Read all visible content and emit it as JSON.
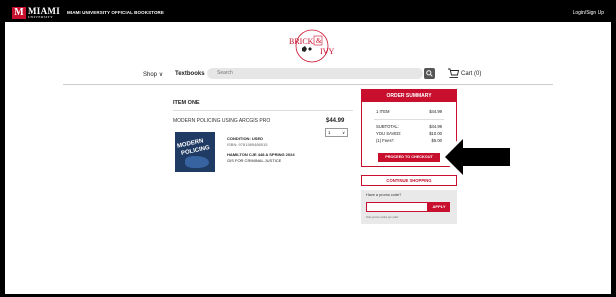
{
  "header": {
    "logo_line1": "MIAMI",
    "logo_line2": "UNIVERSITY",
    "store_title": "MIAMI UNIVERSITY OFFICIAL BOOKSTORE",
    "login": "Login/Sign Up"
  },
  "brand": {
    "word1": "BRICK",
    "amp": "&",
    "word2": "IVY"
  },
  "nav": {
    "shop": "Shop",
    "textbooks": "Textbooks",
    "search_placeholder": "Search",
    "cart": "Cart (0)"
  },
  "item": {
    "heading": "ITEM ONE",
    "title": "MODERN POLICING USING ARCGIS PRO",
    "price": "$44.99",
    "quantity": "1",
    "cover_word1": "MODERN",
    "cover_word2": "POLICING",
    "condition": "CONDITION: USED",
    "isbn": "ISBN: 9781589486515",
    "course": "HAMILTON CJE 448 A SPRING 2024",
    "course_desc": "GIS FOR CRIMINAL JUSTICE"
  },
  "summary": {
    "heading": "ORDER SUMMARY",
    "items_label": "1 ITEM",
    "items_value": "$44.99",
    "subtotal_label": "SUBTOTAL:",
    "subtotal_value": "$44.99",
    "saved_label": "YOU SAVED:",
    "saved_value": "$10.00",
    "fees_label": "(1) Fees*:",
    "fees_value": "$5.00",
    "checkout": "PROCEED TO CHECKOUT"
  },
  "continue_shopping": "CONTINUE SHOPPING",
  "promo": {
    "label": "Have a promo code?",
    "apply": "APPLY",
    "note": "Note promo codes per order"
  },
  "colors": {
    "accent": "#c8102e",
    "navy": "#1f3a63"
  }
}
